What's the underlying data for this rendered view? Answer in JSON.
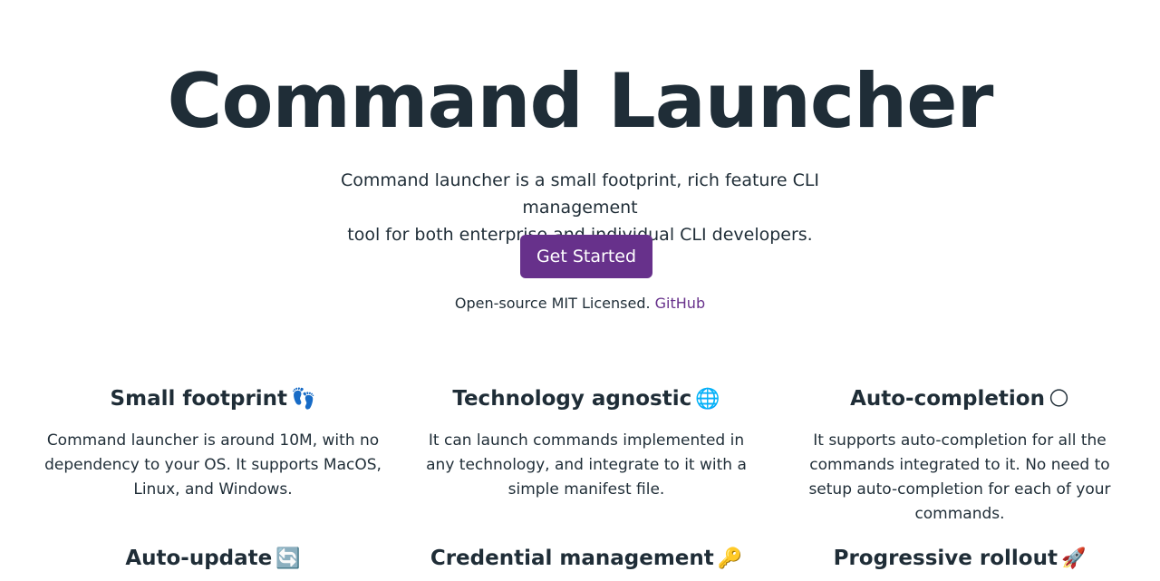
{
  "hero": {
    "title": "Command Launcher",
    "subtitle_line1": "Command launcher is a small footprint, rich feature CLI management",
    "subtitle_line2": "tool for both enterprise and individual CLI developers.",
    "cta_label": "Get Started",
    "license_text": "Open-source MIT Licensed.",
    "github_link": "GitHub"
  },
  "features": [
    {
      "title": "Small footprint",
      "emoji": "👣",
      "icon": "footprints-icon",
      "description": "Command launcher is around 10M, with no dependency to your OS. It supports MacOS, Linux, and Windows."
    },
    {
      "title": "Technology agnostic",
      "emoji": "🌐",
      "icon": "globe-icon",
      "description": "It can launch commands implemented in any technology, and integrate to it with a simple manifest file."
    },
    {
      "title": "Auto-completion",
      "emoji": "🌕",
      "icon": "full-moon-icon",
      "description": "It supports auto-completion for all the commands integrated to it. No need to setup auto-completion for each of your commands."
    },
    {
      "title": "Auto-update",
      "emoji": "🔄",
      "icon": "refresh-icon",
      "description": ""
    },
    {
      "title": "Credential management",
      "emoji": "🔑",
      "icon": "key-icon",
      "description": ""
    },
    {
      "title": "Progressive rollout",
      "emoji": "🚀",
      "icon": "rocket-icon",
      "description": ""
    }
  ],
  "colors": {
    "text": "#1f2d37",
    "accent": "#67318b",
    "background": "#ffffff"
  }
}
